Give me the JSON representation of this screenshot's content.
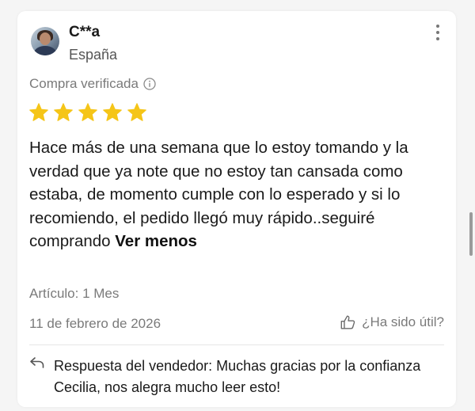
{
  "review": {
    "username": "C**a",
    "country": "España",
    "verified_label": "Compra verificada",
    "rating": 5,
    "text": "Hace más de una semana que lo estoy tomando y la verdad que ya note que no estoy tan cansada como estaba, de momento cumple con lo esperado y si lo recomiendo, el pedido llegó muy rápido..seguiré comprando ",
    "see_less_label": "Ver menos",
    "article": "Artículo: 1 Mes",
    "date": "11 de febrero de 2026",
    "helpful_label": "¿Ha sido útil?"
  },
  "seller_reply": {
    "text": "Respuesta del vendedor: Muchas gracias por la confianza Cecilia, nos alegra mucho leer esto!"
  },
  "colors": {
    "star": "#F5C518",
    "muted_text": "#7a7a7a",
    "body_text": "#1a1a1a"
  },
  "icons": {
    "more": "more-vertical-icon",
    "info": "info-icon",
    "star": "star-icon",
    "thumb": "thumbs-up-icon",
    "reply": "reply-icon"
  }
}
